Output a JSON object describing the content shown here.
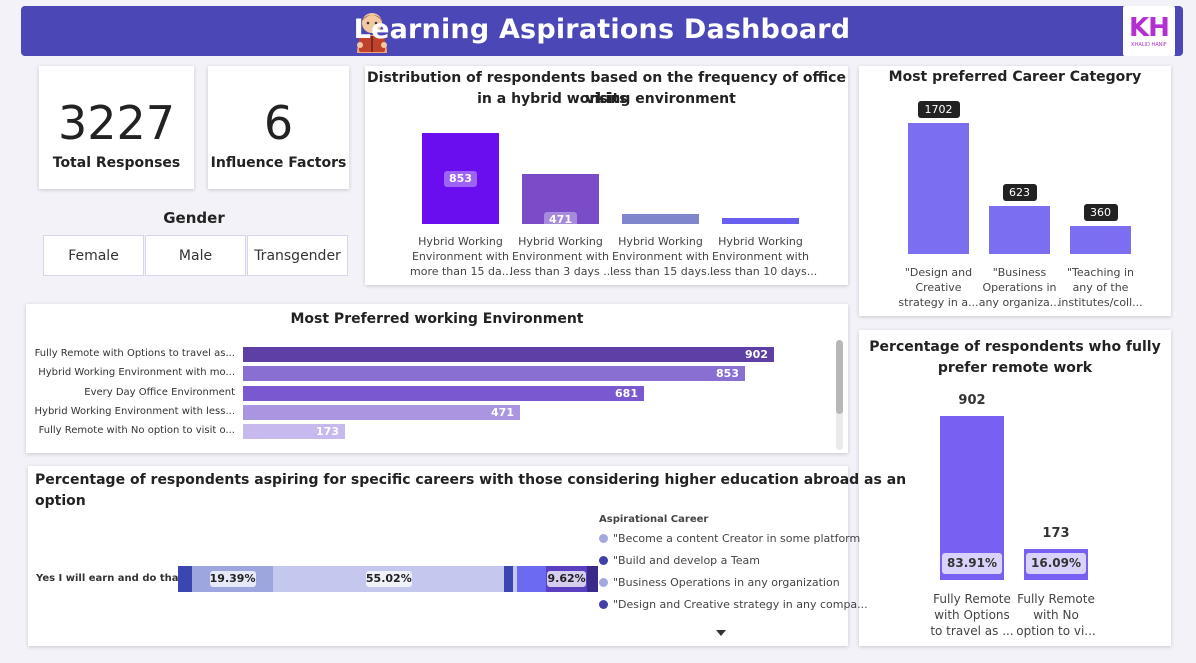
{
  "header": {
    "title": "Learning Aspirations Dashboard",
    "logo_text": "KH",
    "logo_sub": "KHALID HANIF"
  },
  "kpis": [
    {
      "value": "3227",
      "label": "Total Responses"
    },
    {
      "value": "6",
      "label": "Influence Factors"
    }
  ],
  "gender": {
    "title": "Gender",
    "options": [
      "Female",
      "Male",
      "Transgender"
    ]
  },
  "office_visits": {
    "title_line1": "Distribution of respondents based on the frequency of office visits",
    "title_line2": "in a hybrid working environment"
  },
  "career_category": {
    "title": "Most preferred Career Category"
  },
  "working_env": {
    "title": "Most Preferred working Environment"
  },
  "remote_pct": {
    "title_line1": "Percentage of respondents who fully",
    "title_line2": "prefer remote work"
  },
  "aspiring": {
    "title_line1": "Percentage of respondents aspiring for specific careers with those considering higher education abroad as an",
    "title_line2": "option",
    "legend_title": "Aspirational Career",
    "row_label": "Yes I will earn and do that",
    "legend": [
      {
        "label": "\"Become a content Creator in some platform",
        "color": "#a4a8e0"
      },
      {
        "label": "\"Build and develop a Team",
        "color": "#4040a8"
      },
      {
        "label": "\"Business Operations in any organization",
        "color": "#a4a8e0"
      },
      {
        "label": "\"Design and Creative strategy in any compa...",
        "color": "#4040a8"
      }
    ],
    "segment_labels": [
      "19.39%",
      "55.02%",
      "9.62%"
    ]
  },
  "chart_data": [
    {
      "type": "bar",
      "title": "Distribution of respondents based on the frequency of office visits in a hybrid working environment",
      "categories": [
        [
          "Hybrid Working",
          "Environment with",
          "more than 15 da..."
        ],
        [
          "Hybrid Working",
          "Environment with",
          "less than 3 days ..."
        ],
        [
          "Hybrid Working",
          "Environment with",
          "less than 15 days..."
        ],
        [
          "Hybrid Working",
          "Environment with",
          "less than 10 days..."
        ]
      ],
      "values": [
        853,
        471,
        95,
        60
      ],
      "value_labels": [
        "853",
        "471",
        "",
        ""
      ],
      "colors": [
        "#6a0ef0",
        "#7a4cc8",
        "#7f86cc",
        "#6a5ef0"
      ]
    },
    {
      "type": "bar",
      "title": "Most preferred Career Category",
      "categories": [
        [
          "\"Design and",
          "Creative",
          "strategy in a..."
        ],
        [
          "\"Business",
          "Operations in",
          "any organiza..."
        ],
        [
          "\"Teaching in",
          "any of the",
          "institutes/coll..."
        ]
      ],
      "values": [
        1702,
        623,
        360
      ],
      "color": "#7b6ef0"
    },
    {
      "type": "bar",
      "orientation": "horizontal",
      "title": "Most Preferred working Environment",
      "categories": [
        "Fully Remote with Options to travel as...",
        "Hybrid Working Environment with mo...",
        "Every Day Office Environment",
        "Hybrid Working Environment with less...",
        "Fully Remote with No option to visit o..."
      ],
      "values": [
        902,
        853,
        681,
        471,
        173
      ],
      "colors": [
        "#5e3fa6",
        "#8a6fd2",
        "#7a58cf",
        "#aa96e0",
        "#c7b8ee"
      ]
    },
    {
      "type": "bar",
      "title": "Percentage of respondents who fully prefer remote work",
      "categories": [
        [
          "Fully Remote",
          "with Options",
          "to travel as ..."
        ],
        [
          "Fully Remote",
          "with No",
          "option to vi..."
        ]
      ],
      "values": [
        902,
        173
      ],
      "percent_labels": [
        "83.91%",
        "16.09%"
      ],
      "color": "#7760f2"
    },
    {
      "type": "bar",
      "orientation": "horizontal-stacked",
      "title": "Percentage of respondents aspiring for specific careers with those considering higher education abroad as an option",
      "categories": [
        "Yes I will earn and do that"
      ],
      "segments": [
        {
          "value": 3.3,
          "color": "#3b46b0"
        },
        {
          "value": 19.39,
          "color": "#9da6de",
          "label": "19.39%"
        },
        {
          "value": 55.02,
          "color": "#c4c8ee",
          "label": "55.02%"
        },
        {
          "value": 2.0,
          "color": "#3b46b0"
        },
        {
          "value": 1.0,
          "color": "#c4c8ee"
        },
        {
          "value": 7.0,
          "color": "#6b6af0"
        },
        {
          "value": 9.62,
          "color": "#5a3fc0",
          "label": "9.62%"
        },
        {
          "value": 2.67,
          "color": "#3a2a8a"
        }
      ]
    }
  ]
}
